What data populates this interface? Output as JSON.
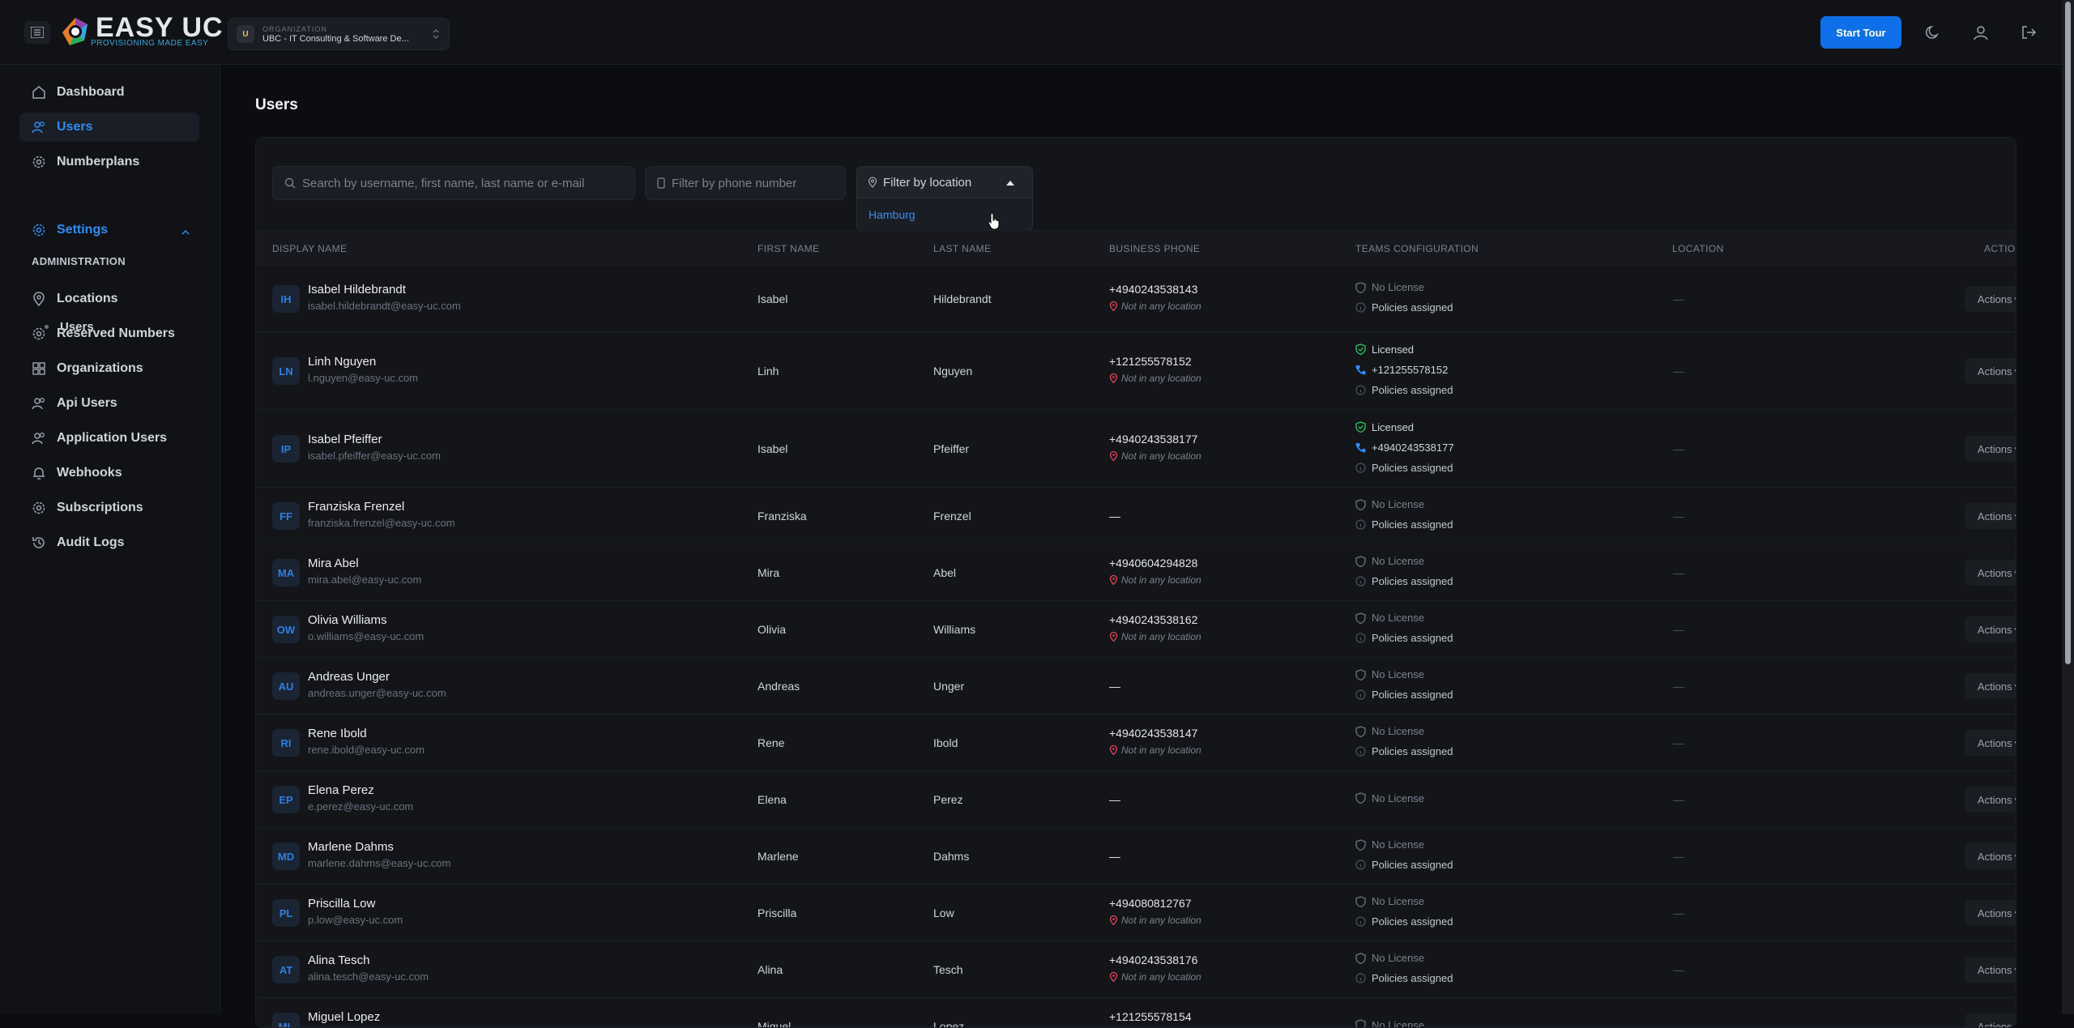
{
  "topbar": {
    "logo_main": "EASY",
    "logo_uc": "UC",
    "logo_sub": "PROVISIONING MADE EASY",
    "org_caption": "ORGANIZATION",
    "org_badge": "U",
    "org_name": "UBC - IT Consulting & Software De...",
    "start_tour": "Start Tour"
  },
  "sidebar": {
    "items": [
      {
        "label": "Dashboard",
        "icon": "home-icon"
      },
      {
        "label": "Users",
        "icon": "users-icon",
        "active": true
      },
      {
        "label": "Numberplans",
        "icon": "gear-icon"
      }
    ],
    "section_label": "ADMINISTRATION",
    "admin_items": [
      {
        "label": "Settings",
        "icon": "gear-icon"
      },
      {
        "label": "Locations",
        "icon": "location-icon"
      },
      {
        "label": "Reserved Numbers",
        "icon": "gear-icon"
      },
      {
        "label": "Organizations",
        "icon": "grid-icon"
      },
      {
        "label": "Api Users",
        "icon": "users-icon"
      },
      {
        "label": "Application Users",
        "icon": "users-icon"
      },
      {
        "label": "Webhooks",
        "icon": "bell-icon"
      },
      {
        "label": "Subscriptions",
        "icon": "gear-icon"
      },
      {
        "label": "Audit Logs",
        "icon": "history-icon"
      }
    ],
    "settings_sub": "Users"
  },
  "page": {
    "title": "Users",
    "search_placeholder": "Search by username, first name, last name or e-mail",
    "phone_placeholder": "Filter by phone number",
    "location_placeholder": "Filter by location",
    "location_option": "Hamburg"
  },
  "table": {
    "headers": [
      "DISPLAY NAME",
      "FIRST NAME",
      "LAST NAME",
      "BUSINESS PHONE",
      "TEAMS CONFIGURATION",
      "LOCATION",
      "ACTIONS"
    ],
    "no_location": "Not in any location",
    "no_license": "No License",
    "licensed": "Licensed",
    "policies": "Policies assigned",
    "empty": "—",
    "actions_label": "Actions",
    "rows": [
      {
        "initials": "IH",
        "name": "Isabel Hildebrandt",
        "email": "isabel.hildebrandt@easy-uc.com",
        "first": "Isabel",
        "last": "Hildebrandt",
        "phone": "+4940243538143",
        "licensed": false,
        "teams_phone": "",
        "policies": true
      },
      {
        "initials": "LN",
        "name": "Linh Nguyen",
        "email": "l.nguyen@easy-uc.com",
        "first": "Linh",
        "last": "Nguyen",
        "phone": "+121255578152",
        "licensed": true,
        "teams_phone": "+121255578152",
        "policies": true
      },
      {
        "initials": "IP",
        "name": "Isabel Pfeiffer",
        "email": "isabel.pfeiffer@easy-uc.com",
        "first": "Isabel",
        "last": "Pfeiffer",
        "phone": "+4940243538177",
        "licensed": true,
        "teams_phone": "+4940243538177",
        "policies": true
      },
      {
        "initials": "FF",
        "name": "Franziska Frenzel",
        "email": "franziska.frenzel@easy-uc.com",
        "first": "Franziska",
        "last": "Frenzel",
        "phone": "",
        "licensed": false,
        "teams_phone": "",
        "policies": true
      },
      {
        "initials": "MA",
        "name": "Mira Abel",
        "email": "mira.abel@easy-uc.com",
        "first": "Mira",
        "last": "Abel",
        "phone": "+4940604294828",
        "licensed": false,
        "teams_phone": "",
        "policies": true
      },
      {
        "initials": "OW",
        "name": "Olivia Williams",
        "email": "o.williams@easy-uc.com",
        "first": "Olivia",
        "last": "Williams",
        "phone": "+4940243538162",
        "licensed": false,
        "teams_phone": "",
        "policies": true
      },
      {
        "initials": "AU",
        "name": "Andreas Unger",
        "email": "andreas.unger@easy-uc.com",
        "first": "Andreas",
        "last": "Unger",
        "phone": "",
        "licensed": false,
        "teams_phone": "",
        "policies": true
      },
      {
        "initials": "RI",
        "name": "Rene Ibold",
        "email": "rene.ibold@easy-uc.com",
        "first": "Rene",
        "last": "Ibold",
        "phone": "+4940243538147",
        "licensed": false,
        "teams_phone": "",
        "policies": true
      },
      {
        "initials": "EP",
        "name": "Elena Perez",
        "email": "e.perez@easy-uc.com",
        "first": "Elena",
        "last": "Perez",
        "phone": "",
        "licensed": false,
        "teams_phone": "",
        "policies": false
      },
      {
        "initials": "MD",
        "name": "Marlene Dahms",
        "email": "marlene.dahms@easy-uc.com",
        "first": "Marlene",
        "last": "Dahms",
        "phone": "",
        "licensed": false,
        "teams_phone": "",
        "policies": true
      },
      {
        "initials": "PL",
        "name": "Priscilla Low",
        "email": "p.low@easy-uc.com",
        "first": "Priscilla",
        "last": "Low",
        "phone": "+494080812767",
        "licensed": false,
        "teams_phone": "",
        "policies": true
      },
      {
        "initials": "AT",
        "name": "Alina Tesch",
        "email": "alina.tesch@easy-uc.com",
        "first": "Alina",
        "last": "Tesch",
        "phone": "+4940243538176",
        "licensed": false,
        "teams_phone": "",
        "policies": true
      },
      {
        "initials": "ML",
        "name": "Miguel Lopez",
        "email": "",
        "first": "Miguel",
        "last": "Lopez",
        "phone": "+121255578154",
        "licensed": false,
        "teams_phone": "",
        "policies": false
      }
    ]
  }
}
